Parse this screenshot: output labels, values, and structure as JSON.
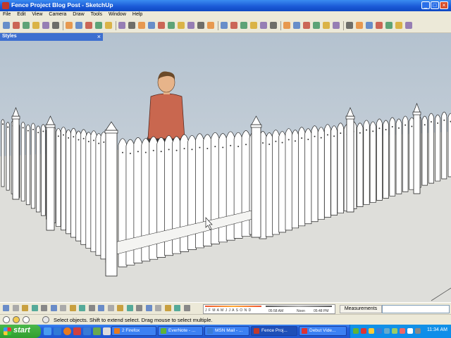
{
  "window": {
    "title": "Fence Project Blog Post - SketchUp",
    "minimize": "_",
    "maximize": "□",
    "close": "×"
  },
  "menu": [
    "File",
    "Edit",
    "View",
    "Camera",
    "Draw",
    "Tools",
    "Window",
    "Help"
  ],
  "panel": {
    "title": "Styles",
    "close": "×"
  },
  "toolbar": {
    "icons": [
      "new-file-icon",
      "open-file-icon",
      "save-icon",
      "cut-icon",
      "copy-icon",
      "paste-icon",
      "erase-icon",
      "undo-icon",
      "redo-icon",
      "print-icon",
      "model-info-icon",
      "select-arrow-icon",
      "component-icon",
      "paint-bucket-icon",
      "eraser-icon",
      "rectangle-icon",
      "line-icon",
      "circle-icon",
      "arc-icon",
      "polygon-icon",
      "freehand-icon",
      "move-icon",
      "push-pull-icon",
      "rotate-icon",
      "follow-me-icon",
      "scale-icon",
      "offset-icon",
      "tape-measure-icon",
      "dimension-icon",
      "protractor-icon",
      "text-icon",
      "axes-icon",
      "3d-text-icon",
      "orbit-icon",
      "pan-icon",
      "zoom-icon",
      "zoom-window-icon",
      "zoom-extents-icon",
      "previous-view-icon",
      "next-view-icon"
    ]
  },
  "bottom_toolbar": {
    "months": "J F M A M J J A S O N D",
    "time_start": "05:58 AM",
    "time_mid": "Noon",
    "time_end": "05:48 PM",
    "measurements_label": "Measurements",
    "measurements_value": ""
  },
  "status": {
    "text": "Select objects. Shift to extend select. Drag mouse to select multiple."
  },
  "taskbar": {
    "start_label": "start",
    "tasks": [
      {
        "label": "2 Firefox",
        "icon": "firefox-icon",
        "color": "#e87a1e"
      },
      {
        "label": "EverNote - ...",
        "icon": "evernote-icon",
        "color": "#5fb336"
      },
      {
        "label": "MSN Mail - ...",
        "icon": "msn-icon",
        "color": "#3a7bd5"
      },
      {
        "label": "Fence Proj...",
        "icon": "sketchup-icon",
        "color": "#c0392b"
      },
      {
        "label": "Debut Vide...",
        "icon": "debut-icon",
        "color": "#d33"
      }
    ],
    "clock": "11:34 AM"
  },
  "colors": {
    "sky": "#c5cfd9",
    "ground": "#dcdcd7",
    "fence": "#ffffff",
    "titlebar": "#1958d6"
  }
}
